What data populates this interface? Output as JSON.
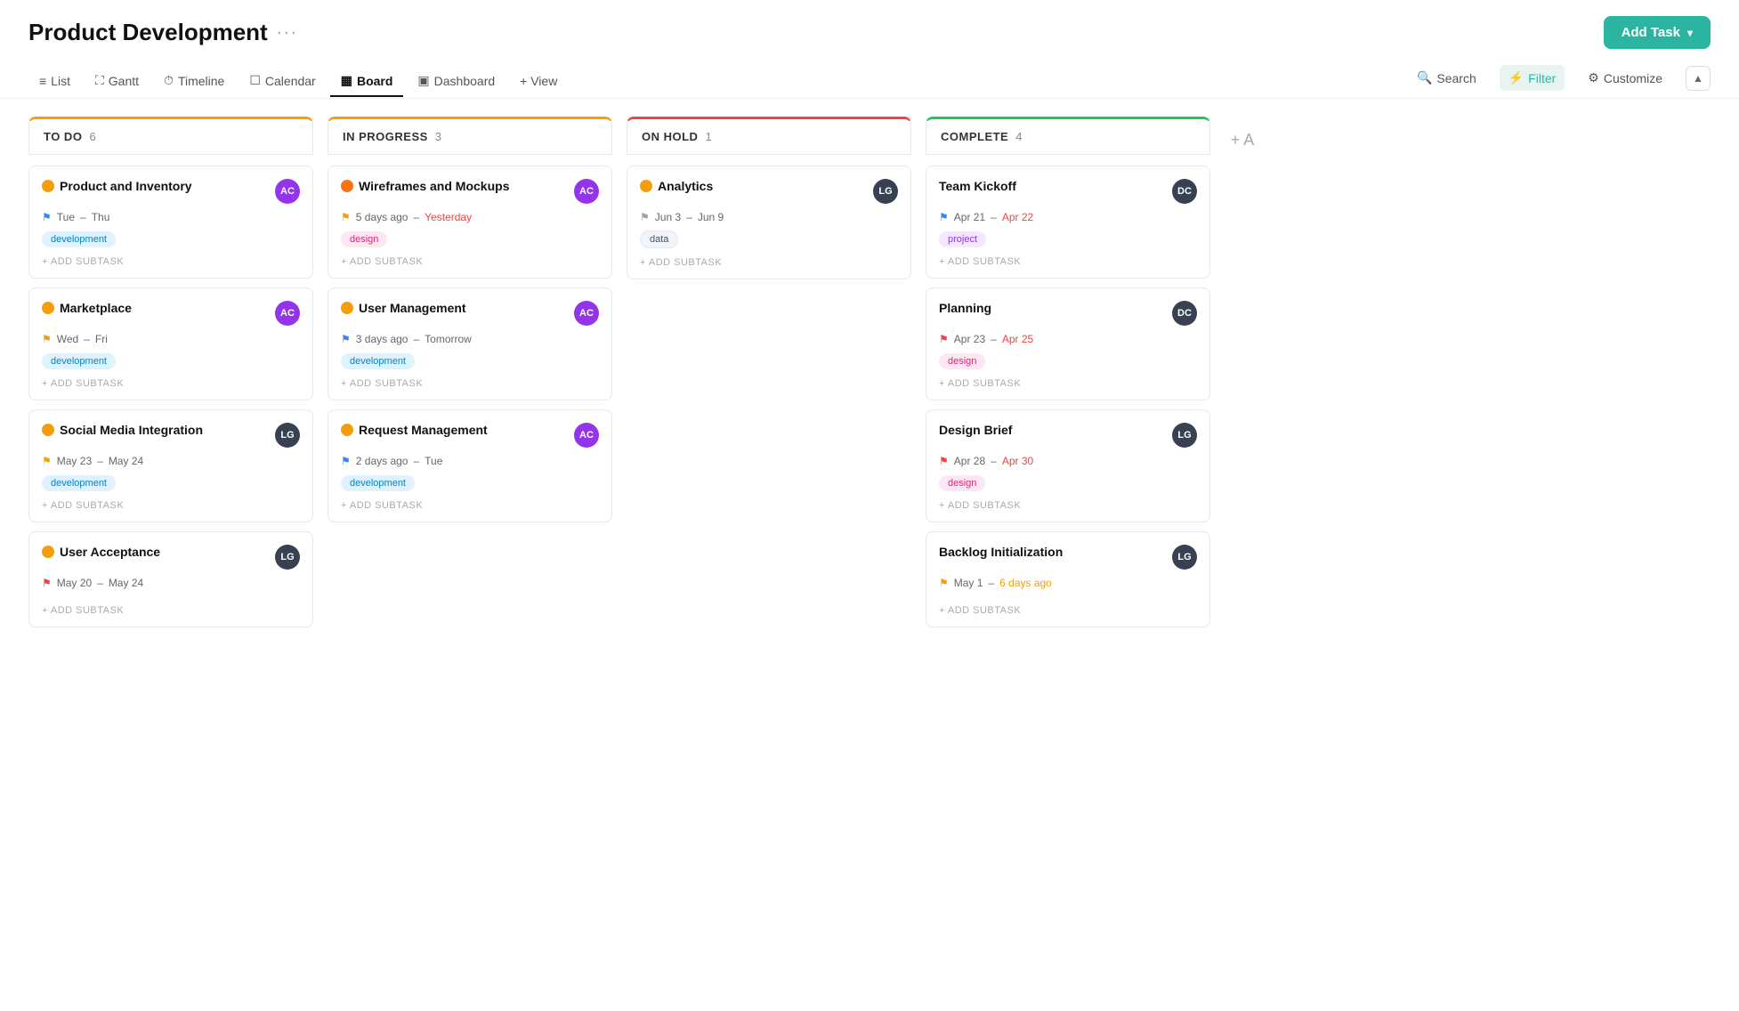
{
  "header": {
    "title": "Product Development",
    "more_label": "···",
    "add_task_label": "Add Task"
  },
  "nav": {
    "items": [
      {
        "id": "list",
        "label": "List",
        "icon": "≡",
        "active": false
      },
      {
        "id": "gantt",
        "label": "Gantt",
        "icon": "📊",
        "active": false
      },
      {
        "id": "timeline",
        "label": "Timeline",
        "icon": "📅",
        "active": false
      },
      {
        "id": "calendar",
        "label": "Calendar",
        "icon": "🗓",
        "active": false
      },
      {
        "id": "board",
        "label": "Board",
        "icon": "▦",
        "active": true
      },
      {
        "id": "dashboard",
        "label": "Dashboard",
        "icon": "📈",
        "active": false
      },
      {
        "id": "view",
        "label": "+ View",
        "icon": "",
        "active": false
      }
    ],
    "actions": [
      {
        "id": "search",
        "label": "Search",
        "icon": "🔍"
      },
      {
        "id": "filter",
        "label": "Filter",
        "icon": "⚙",
        "active": true
      },
      {
        "id": "customize",
        "label": "Customize",
        "icon": "⚙"
      }
    ]
  },
  "columns": [
    {
      "id": "todo",
      "title": "TO DO",
      "count": 6,
      "color_class": "todo",
      "cards": [
        {
          "id": "c1",
          "title": "Product and Inventory",
          "status": "yellow",
          "avatar_initials": "AC",
          "avatar_class": "purple",
          "flag_class": "flag-blue",
          "date_start": "Tue",
          "date_sep": "–",
          "date_end": "Thu",
          "date_end_class": "date-normal",
          "tag_label": "development",
          "tag_class": "development",
          "subtask_label": "+ ADD SUBTASK"
        },
        {
          "id": "c2",
          "title": "Marketplace",
          "status": "yellow",
          "avatar_initials": "AC",
          "avatar_class": "purple",
          "flag_class": "flag-yellow",
          "date_start": "Wed",
          "date_sep": "–",
          "date_end": "Fri",
          "date_end_class": "date-normal",
          "tag_label": "development",
          "tag_class": "development",
          "subtask_label": "+ ADD SUBTASK"
        },
        {
          "id": "c3",
          "title": "Social Media Integration",
          "status": "yellow",
          "avatar_initials": "LG",
          "avatar_class": "dark",
          "flag_class": "flag-yellow",
          "date_start": "May 23",
          "date_sep": "–",
          "date_end": "May 24",
          "date_end_class": "date-normal",
          "tag_label": "development",
          "tag_class": "development",
          "subtask_label": "+ ADD SUBTASK"
        },
        {
          "id": "c4",
          "title": "User Acceptance",
          "status": "yellow",
          "avatar_initials": "LG",
          "avatar_class": "dark",
          "flag_class": "flag-red",
          "date_start": "May 20",
          "date_sep": "–",
          "date_end": "May 24",
          "date_end_class": "date-normal",
          "tag_label": "",
          "tag_class": "",
          "subtask_label": "+ ADD SUBTASK"
        }
      ]
    },
    {
      "id": "inprogress",
      "title": "IN PROGRESS",
      "count": 3,
      "color_class": "inprogress",
      "cards": [
        {
          "id": "c5",
          "title": "Wireframes and Mockups",
          "status": "orange",
          "avatar_initials": "AC",
          "avatar_class": "purple",
          "flag_class": "flag-yellow",
          "date_start": "5 days ago",
          "date_sep": "–",
          "date_end": "Yesterday",
          "date_end_class": "date-overdue",
          "tag_label": "design",
          "tag_class": "design",
          "subtask_label": "+ ADD SUBTASK"
        },
        {
          "id": "c6",
          "title": "User Management",
          "status": "yellow",
          "avatar_initials": "AC",
          "avatar_class": "purple",
          "flag_class": "flag-blue",
          "date_start": "3 days ago",
          "date_sep": "–",
          "date_end": "Tomorrow",
          "date_end_class": "date-normal",
          "tag_label": "development",
          "tag_class": "development",
          "subtask_label": "+ ADD SUBTASK"
        },
        {
          "id": "c7",
          "title": "Request Management",
          "status": "yellow",
          "avatar_initials": "AC",
          "avatar_class": "purple",
          "flag_class": "flag-blue",
          "date_start": "2 days ago",
          "date_sep": "–",
          "date_end": "Tue",
          "date_end_class": "date-normal",
          "tag_label": "development",
          "tag_class": "development",
          "subtask_label": "+ ADD SUBTASK"
        }
      ]
    },
    {
      "id": "onhold",
      "title": "ON HOLD",
      "count": 1,
      "color_class": "onhold",
      "cards": [
        {
          "id": "c8",
          "title": "Analytics",
          "status": "yellow",
          "avatar_initials": "LG",
          "avatar_class": "dark",
          "flag_class": "flag-gray",
          "date_start": "Jun 3",
          "date_sep": "–",
          "date_end": "Jun 9",
          "date_end_class": "date-normal",
          "tag_label": "data",
          "tag_class": "data",
          "subtask_label": "+ ADD SUBTASK"
        }
      ]
    },
    {
      "id": "complete",
      "title": "COMPLETE",
      "count": 4,
      "color_class": "complete",
      "cards": [
        {
          "id": "c9",
          "title": "Team Kickoff",
          "status": null,
          "avatar_initials": "DC",
          "avatar_class": "dark",
          "flag_class": "flag-blue",
          "date_start": "Apr 21",
          "date_sep": "–",
          "date_end": "Apr 22",
          "date_end_class": "date-overdue",
          "tag_label": "project",
          "tag_class": "project",
          "subtask_label": "+ ADD SUBTASK"
        },
        {
          "id": "c10",
          "title": "Planning",
          "status": null,
          "avatar_initials": "DC",
          "avatar_class": "dark",
          "flag_class": "flag-red",
          "date_start": "Apr 23",
          "date_sep": "–",
          "date_end": "Apr 25",
          "date_end_class": "date-overdue",
          "tag_label": "design",
          "tag_class": "design",
          "subtask_label": "+ ADD SUBTASK"
        },
        {
          "id": "c11",
          "title": "Design Brief",
          "status": null,
          "avatar_initials": "LG",
          "avatar_class": "dark",
          "flag_class": "flag-red",
          "date_start": "Apr 28",
          "date_sep": "–",
          "date_end": "Apr 30",
          "date_end_class": "date-overdue",
          "tag_label": "design",
          "tag_class": "design",
          "subtask_label": "+ ADD SUBTASK"
        },
        {
          "id": "c12",
          "title": "Backlog Initialization",
          "status": null,
          "avatar_initials": "LG",
          "avatar_class": "dark",
          "flag_class": "flag-yellow",
          "date_start": "May 1",
          "date_sep": "–",
          "date_end": "6 days ago",
          "date_end_class": "date-warning",
          "tag_label": "",
          "tag_class": "",
          "subtask_label": "+ ADD SUBTASK"
        }
      ]
    }
  ]
}
